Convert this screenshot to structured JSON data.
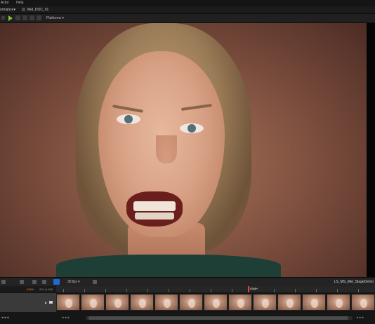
{
  "menu": {
    "items": [
      "Actor",
      "Help"
    ]
  },
  "tabs": {
    "left_label": "ormance▾",
    "asset_label": "Mel_DOC_01"
  },
  "toolbar": {
    "platforms_label": "Platforms ▾"
  },
  "sequencer": {
    "fps_label": "30 fps ▾",
    "sequence_name": "LS_MS_Mel_StageDemo",
    "current_frame": "0268+",
    "range_label": "226 of 458",
    "playhead_label": "0268+"
  },
  "timeline": {
    "thumbnail_count": 13
  },
  "scroll": {
    "left_label": "◂ ◂ ◂",
    "nav_left": "◂ ◂ ◂",
    "nav_right": "▸ ▸ ▸"
  },
  "colors": {
    "accent_blue": "#1e6ad6",
    "playhead": "#e24a2e",
    "play_green": "#7cc53a"
  }
}
